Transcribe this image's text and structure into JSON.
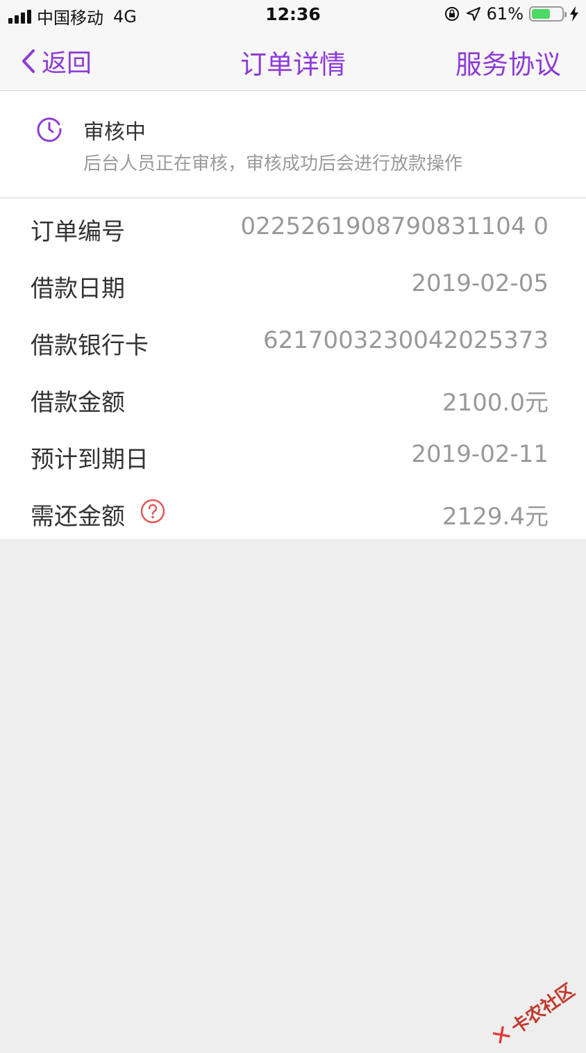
{
  "status_bar": {
    "carrier": "中国移动",
    "network": "4G",
    "time": "12:36",
    "battery": "61%",
    "battery_level": 0.61
  },
  "nav": {
    "back_label": "返回",
    "title": "订单详情",
    "right_label": "服务协议"
  },
  "order_status": {
    "title": "审核中",
    "description": "后台人员正在审核，审核成功后会进行放款操作"
  },
  "details": [
    {
      "label": "订单编号",
      "value": "0225261908790831104 0"
    },
    {
      "label": "借款日期",
      "value": "2019-02-05"
    },
    {
      "label": "借款银行卡",
      "value": "6217003230042025373"
    },
    {
      "label": "借款金额",
      "value": "2100.0元"
    },
    {
      "label": "预计到期日",
      "value": "2019-02-11"
    },
    {
      "label": "需还金额",
      "value": "2129.4元"
    }
  ],
  "watermark": "卡农社区",
  "colors": {
    "accent": "#8e3bd6",
    "help_icon": "#e05a5a",
    "battery": "#4cd964"
  }
}
